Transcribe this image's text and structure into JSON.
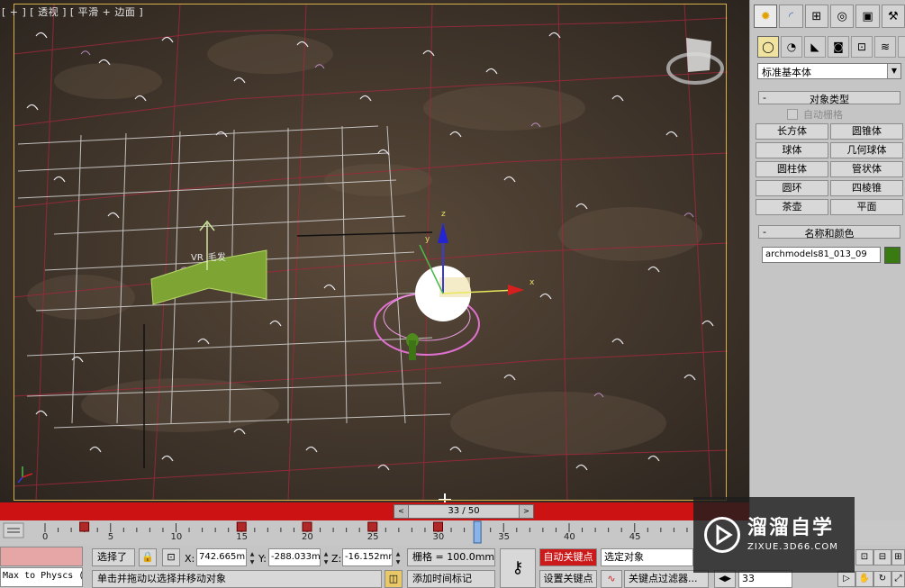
{
  "viewport": {
    "label": "[ + ] [ 透视 ] [ 平滑 + 边面 ]",
    "object_label": "VR_毛发"
  },
  "command_panel": {
    "tabs": [
      "create-icon",
      "modify-icon",
      "hierarchy-icon",
      "motion-icon",
      "display-icon",
      "utilities-icon"
    ],
    "sub_tabs": [
      "geometry-icon",
      "shapes-icon",
      "lights-icon",
      "cameras-icon",
      "helpers-icon",
      "spacewarps-icon",
      "systems-icon"
    ],
    "category": "标准基本体",
    "object_type_title": "对象类型",
    "autogrid_label": "自动栅格",
    "objects": [
      "长方体",
      "圆锥体",
      "球体",
      "几何球体",
      "圆柱体",
      "管状体",
      "圆环",
      "四棱锥",
      "茶壶",
      "平面"
    ],
    "name_color_title": "名称和颜色",
    "object_name": "archmodels81_013_09",
    "object_color": "#3a7a12",
    "rollout_minus": "-"
  },
  "timeline": {
    "slider_text": "33 / 50",
    "left_arrow": "<",
    "right_arrow": ">",
    "ticks": [
      "0",
      "5",
      "10",
      "15",
      "20",
      "25",
      "30",
      "35",
      "40",
      "45"
    ],
    "current_frame": 33,
    "total_frames": 50
  },
  "status": {
    "script_label": "Max to Physcs (",
    "selection": "选择了",
    "x_label": "X:",
    "x_value": "742.665mr",
    "y_label": "Y:",
    "y_value": "-288.033m",
    "z_label": "Z:",
    "z_value": "-16.152mn",
    "grid": "栅格 = 100.0mm",
    "prompt": "单击并拖动以选择并移动对象",
    "add_time_tag": "添加时间标记",
    "auto_key": "自动关键点",
    "selected_object": "选定对象",
    "set_key": "设置关键点",
    "key_filters": "关键点过滤器...",
    "frame_field": "33",
    "accent_color": "#cc1212"
  },
  "watermark": {
    "title": "溜溜自学",
    "url": "ZIXUE.3D66.COM"
  }
}
